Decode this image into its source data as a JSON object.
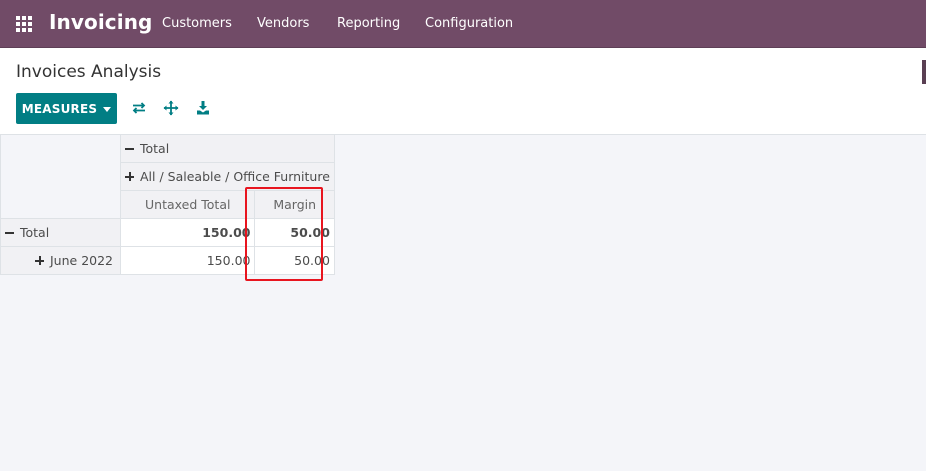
{
  "navbar": {
    "app_title": "Invoicing",
    "menu": [
      "Customers",
      "Vendors",
      "Reporting",
      "Configuration"
    ],
    "background": "#714b67"
  },
  "control_panel": {
    "title": "Invoices Analysis",
    "measures_label": "MEASURES",
    "accent": "#017e84",
    "tools": [
      "flip-axis-icon",
      "expand-all-icon",
      "download-icon"
    ]
  },
  "pivot": {
    "col_total": "Total",
    "col_group": "All / Saleable / Office Furniture",
    "measures": [
      "Untaxed Total",
      "Margin"
    ],
    "rows": [
      {
        "label": "Total",
        "untaxed": "150.00",
        "margin": "50.00"
      },
      {
        "label": "June 2022",
        "untaxed": "150.00",
        "margin": "50.00"
      }
    ]
  }
}
